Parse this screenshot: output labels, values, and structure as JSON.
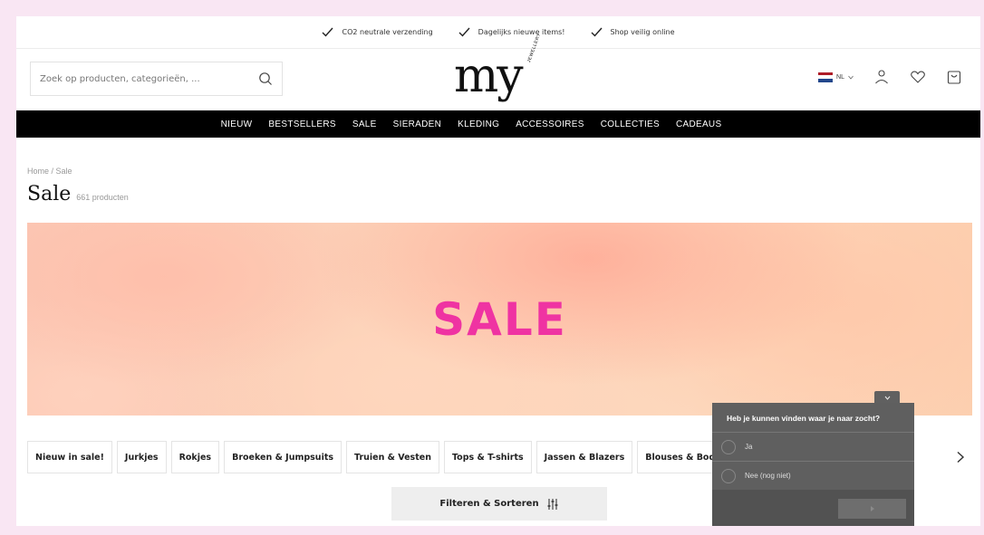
{
  "usp": [
    "CO2 neutrale verzending",
    "Dagelijks nieuwe items!",
    "Shop veilig online"
  ],
  "search": {
    "placeholder": "Zoek op producten, categorieën, ..."
  },
  "logo": {
    "main": "my",
    "sub": "JEWELLERY"
  },
  "language": "NL",
  "nav": [
    "NIEUW",
    "BESTSELLERS",
    "SALE",
    "SIERADEN",
    "KLEDING",
    "ACCESSOIRES",
    "COLLECTIES",
    "CADEAUS"
  ],
  "breadcrumb": "Home / Sale",
  "page": {
    "title": "Sale",
    "count": "661 producten"
  },
  "banner": {
    "text": "SALE"
  },
  "categories": [
    "Nieuw in sale!",
    "Jurkjes",
    "Rokjes",
    "Broeken & Jumpsuits",
    "Truien & Vesten",
    "Tops & T-shirts",
    "Jassen & Blazers",
    "Blouses & Body's"
  ],
  "filter": {
    "label": "Filteren & Sorteren"
  },
  "survey": {
    "question": "Heb je kunnen vinden waar je naar zocht?",
    "options": [
      "Ja",
      "Nee (nog niet)"
    ]
  },
  "colors": {
    "accent": "#ef33a2",
    "nav_bg": "#000000",
    "page_bg": "#f9e6f3",
    "survey_bg": "#5f5f5f"
  },
  "icons": [
    "check-icon",
    "search-icon",
    "flag-nl-icon",
    "chevron-down-icon",
    "user-icon",
    "heart-icon",
    "bag-icon",
    "chevron-right-icon",
    "filter-sliders-icon"
  ]
}
